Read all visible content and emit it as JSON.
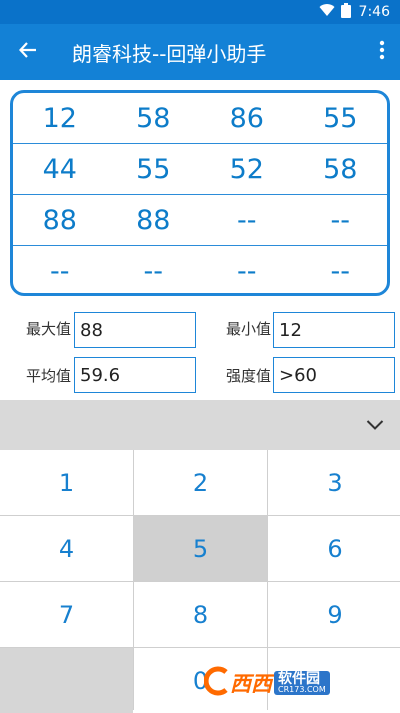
{
  "status_bar": {
    "time": "7:46",
    "icons": [
      "wifi-icon",
      "battery-icon"
    ]
  },
  "app_bar": {
    "title": "朗睿科技--回弹小助手",
    "back_icon": "arrow-left-icon",
    "more_icon": "more-vertical-icon"
  },
  "grid": {
    "rows": [
      [
        "12",
        "58",
        "86",
        "55"
      ],
      [
        "44",
        "55",
        "52",
        "58"
      ],
      [
        "88",
        "88",
        "--",
        "--"
      ],
      [
        "--",
        "--",
        "--",
        "--"
      ]
    ]
  },
  "stats": {
    "max_label": "最大值",
    "max_value": "88",
    "min_label": "最小值",
    "min_value": "12",
    "avg_label": "平均值",
    "avg_value": "59.6",
    "strength_label": "强度值",
    "strength_value": ">60"
  },
  "keyboard": {
    "collapse_icon": "chevron-down-icon",
    "keys": [
      "1",
      "2",
      "3",
      "4",
      "5",
      "6",
      "7",
      "8",
      "9",
      "",
      "0",
      ""
    ]
  },
  "watermark": {
    "logo": "西西",
    "name": "软件园",
    "domain": "CR173.COM"
  },
  "colors": {
    "primary": "#1381d6",
    "status_bar": "#0a72c9",
    "accent_text": "#0d7cc9"
  }
}
